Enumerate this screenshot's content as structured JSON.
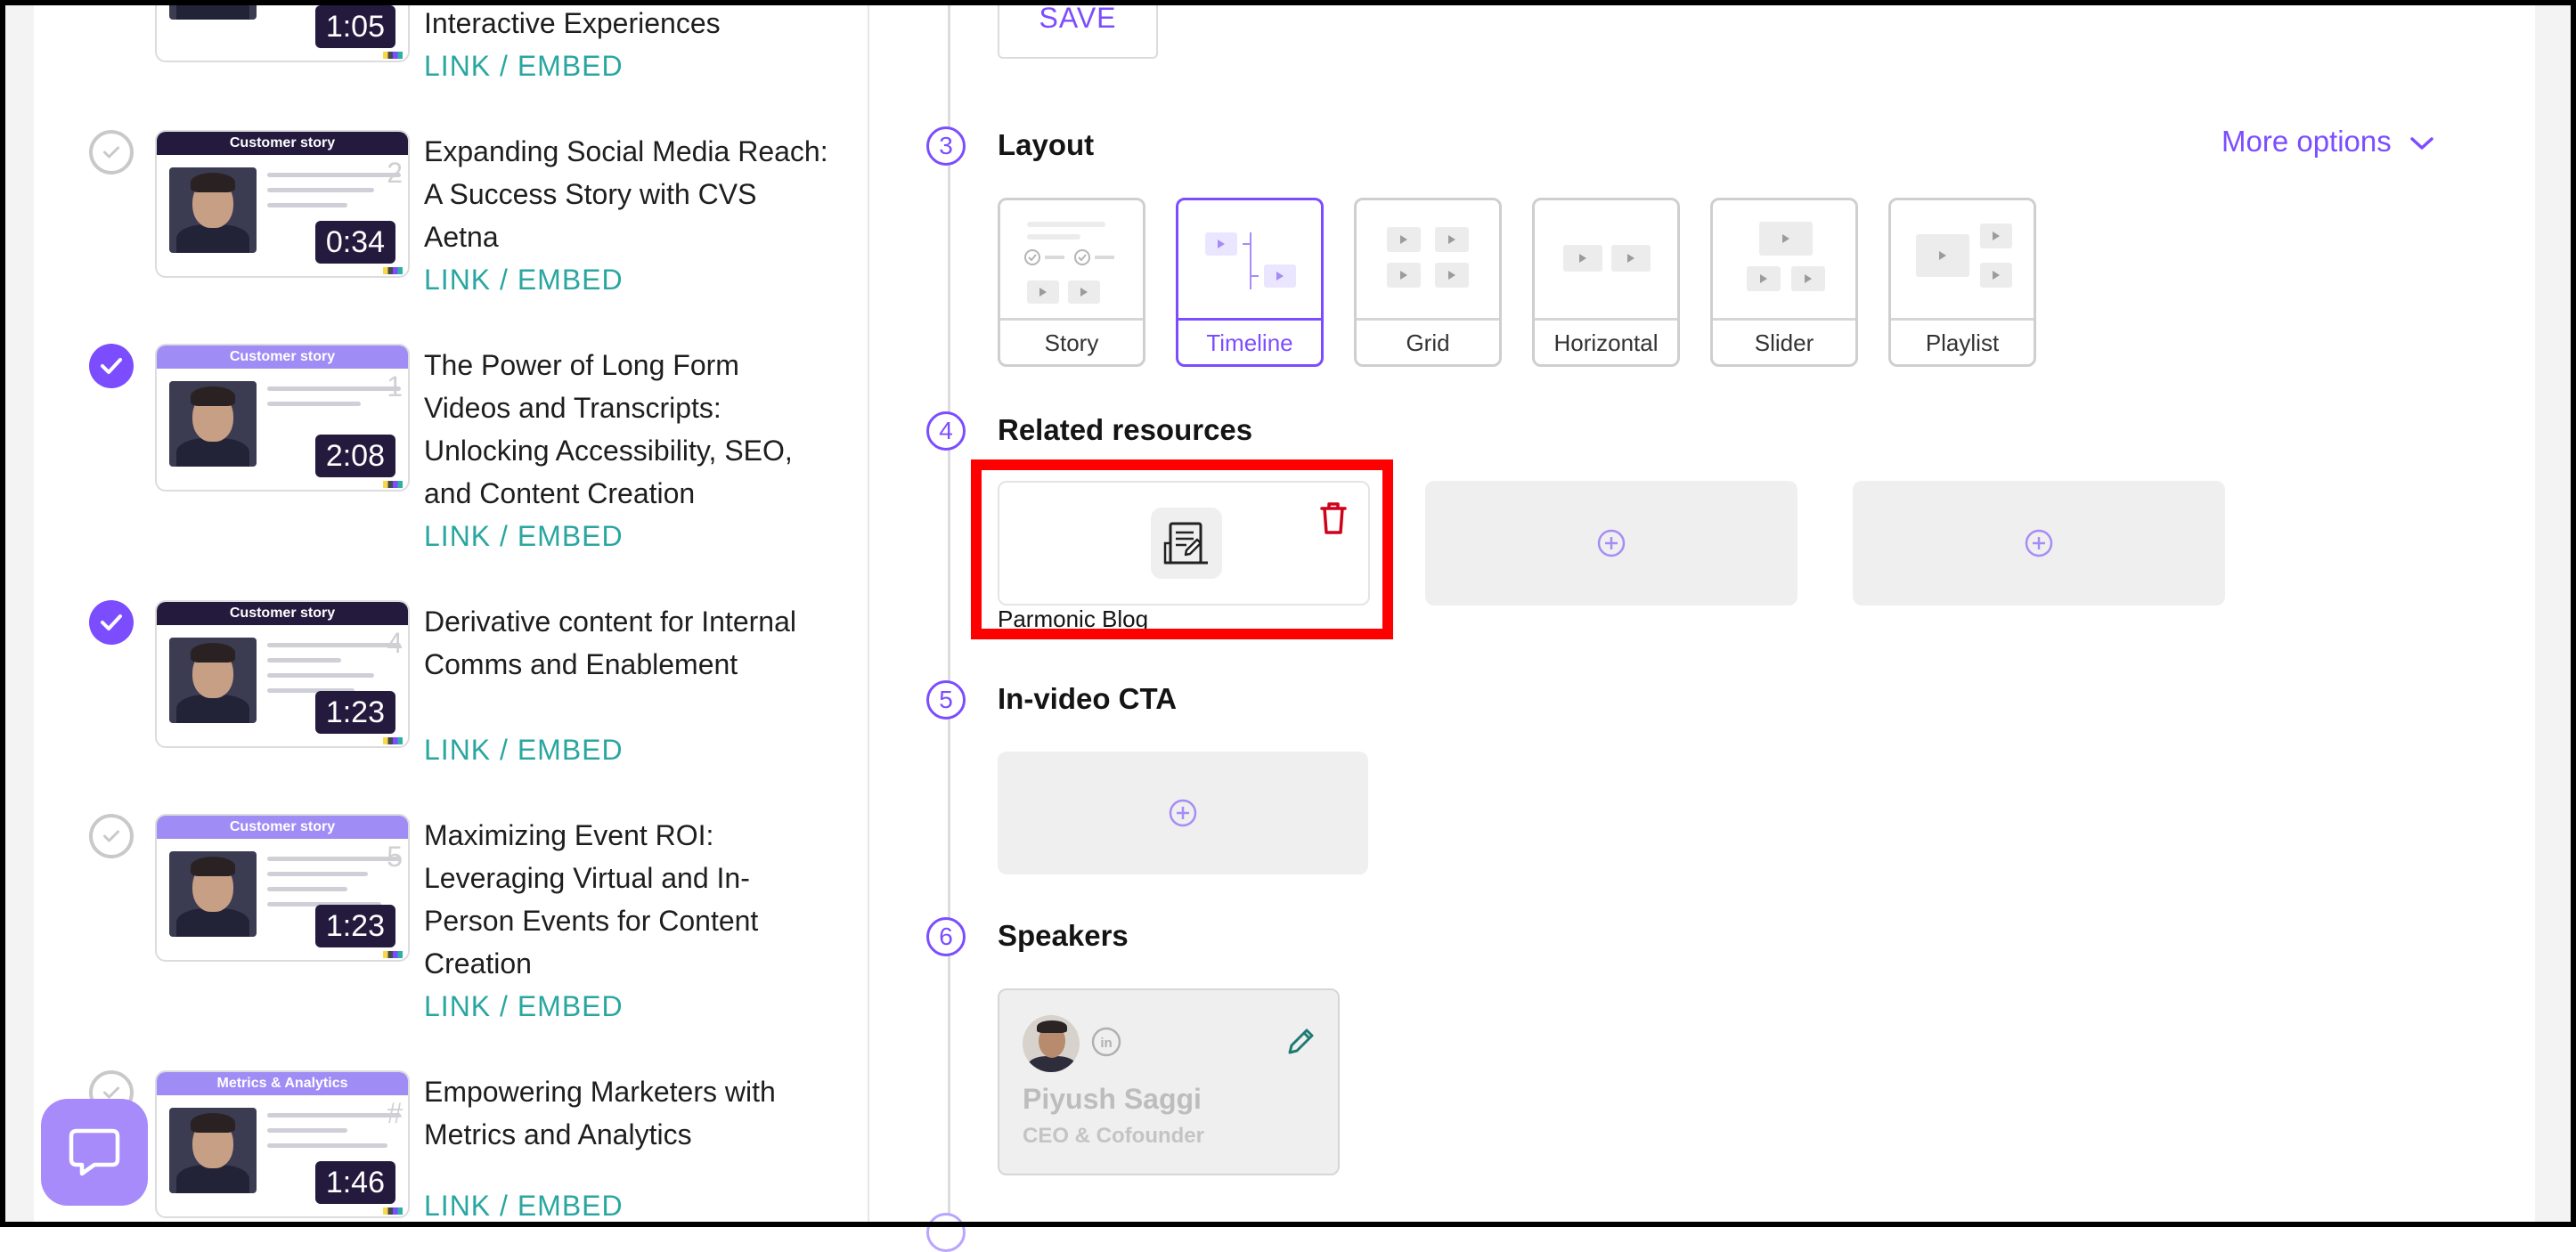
{
  "videos": [
    {
      "title": "Interactive Experiences",
      "link": "LINK / EMBED",
      "duration": "1:05",
      "header": "",
      "checked": false
    },
    {
      "title": "Expanding Social Media Reach: A Success Story with CVS Aetna",
      "link": "LINK / EMBED",
      "duration": "0:34",
      "header": "Customer story",
      "number": "2",
      "checked": false
    },
    {
      "title": "The Power of Long Form Videos and Transcripts: Unlocking Accessibility, SEO, and Content Creation",
      "link": "LINK / EMBED",
      "duration": "2:08",
      "header": "Customer story",
      "number": "1",
      "checked": true
    },
    {
      "title": "Derivative content for Internal Comms and Enablement",
      "link": "LINK / EMBED",
      "duration": "1:23",
      "header": "Customer story",
      "number": "4",
      "checked": true
    },
    {
      "title": "Maximizing Event ROI: Leveraging Virtual and In-Person Events for Content Creation",
      "link": "LINK / EMBED",
      "duration": "1:23",
      "header": "Customer story",
      "number": "5",
      "checked": false
    },
    {
      "title": "Empowering Marketers with Metrics and Analytics",
      "link": "LINK / EMBED",
      "duration": "1:46",
      "header": "Metrics & Analytics",
      "number": "#",
      "checked": false
    }
  ],
  "save_label": "SAVE",
  "steps": {
    "layout": {
      "number": "3",
      "title": "Layout"
    },
    "related": {
      "number": "4",
      "title": "Related resources"
    },
    "cta": {
      "number": "5",
      "title": "In-video CTA"
    },
    "speakers": {
      "number": "6",
      "title": "Speakers"
    }
  },
  "more_options": "More options",
  "layouts": [
    {
      "label": "Story",
      "selected": false
    },
    {
      "label": "Timeline",
      "selected": true
    },
    {
      "label": "Grid",
      "selected": false
    },
    {
      "label": "Horizontal",
      "selected": false
    },
    {
      "label": "Slider",
      "selected": false
    },
    {
      "label": "Playlist",
      "selected": false
    }
  ],
  "related_resource": {
    "name": "Parmonic Blog",
    "icon": "blog-document-icon"
  },
  "speaker": {
    "name": "Piyush Saggi",
    "role": "CEO & Cofounder"
  },
  "colors": {
    "accent": "#7c4dff",
    "link": "#2aa6a0",
    "highlight": "#ff0000",
    "delete": "#d0021b"
  }
}
